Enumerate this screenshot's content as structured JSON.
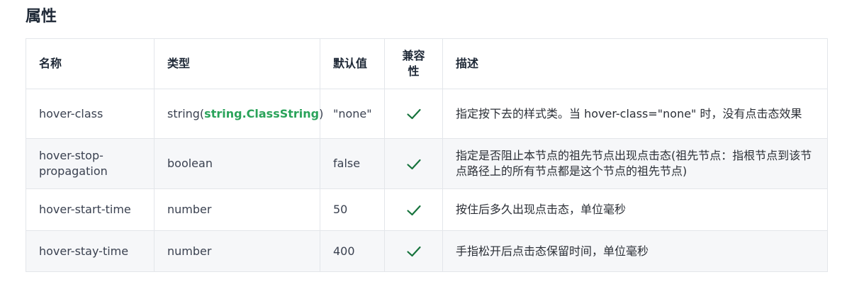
{
  "section": {
    "title": "属性"
  },
  "table": {
    "headers": {
      "name": "名称",
      "type": "类型",
      "default": "默认值",
      "compat_line1": "兼容",
      "compat_line2": "性",
      "desc": "描述"
    },
    "rows": [
      {
        "name": "hover-class",
        "type_prefix": "string(",
        "type_link": "string.ClassString",
        "type_suffix": ")",
        "default": "\"none\"",
        "compatible": true,
        "desc": "指定按下去的样式类。当 hover-class=\"none\" 时，没有点击态效果"
      },
      {
        "name": "hover-stop-propagation",
        "type": "boolean",
        "default": "false",
        "compatible": true,
        "desc": "指定是否阻止本节点的祖先节点出现点击态(祖先节点：指根节点到该节点路径上的所有节点都是这个节点的祖先节点)"
      },
      {
        "name": "hover-start-time",
        "type": "number",
        "default": "50",
        "compatible": true,
        "desc": "按住后多久出现点击态，单位毫秒"
      },
      {
        "name": "hover-stay-time",
        "type": "number",
        "default": "400",
        "compatible": true,
        "desc": "手指松开后点击态保留时间，单位毫秒"
      }
    ]
  },
  "colors": {
    "link": "#2aa35a",
    "check": "#16733c",
    "border": "#e3e6ea",
    "row_alt": "#f6f7f9"
  },
  "icons": {
    "compat": "check-icon"
  }
}
